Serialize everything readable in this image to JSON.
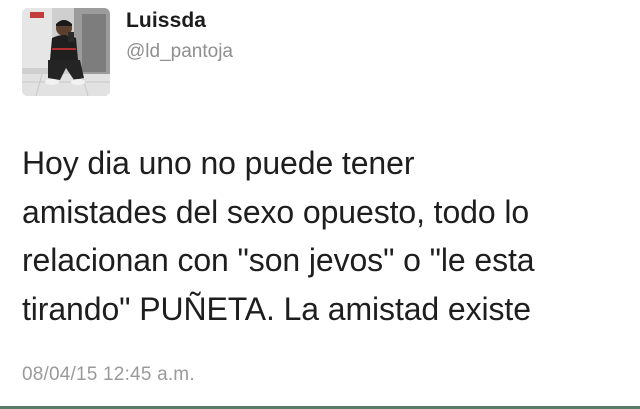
{
  "tweet": {
    "author": {
      "display_name": "Luissda",
      "handle": "@ld_pantoja",
      "avatar_icon": "profile-photo"
    },
    "text": "Hoy dia uno no puede tener\namistades del sexo opuesto, todo lo\nrelacionan con \"son jevos\" o \"le esta\ntirando\" PUÑETA. La amistad existe",
    "timestamp": "08/04/15 12:45 a.m."
  },
  "colors": {
    "handle": "#8f8f8f",
    "timestamp": "#9a9a9a",
    "divider": "#5a7a6a"
  }
}
